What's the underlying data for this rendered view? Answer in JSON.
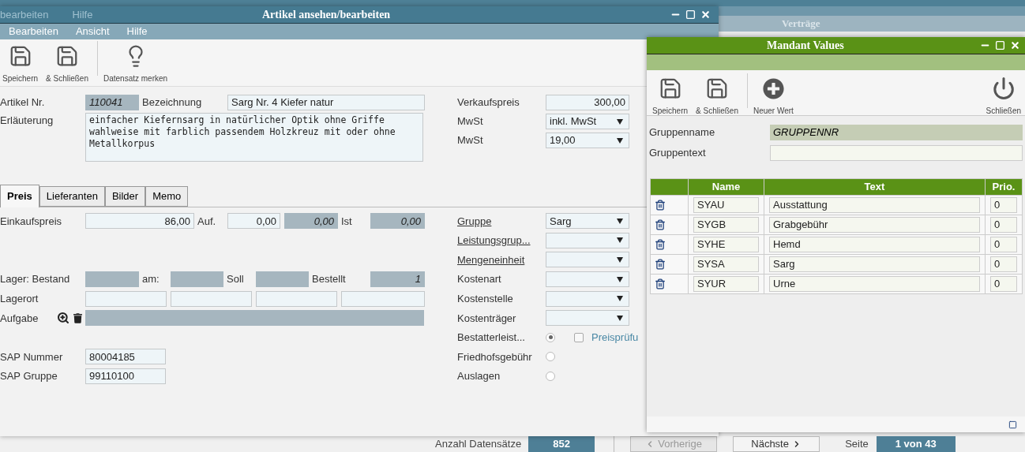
{
  "background": {
    "menu": [
      "bearbeiten",
      "Hilfe"
    ],
    "title": "Verträge",
    "footer": {
      "count_label": "Anzahl Datensätze",
      "count": "852",
      "prev": {
        "label": "Vorherige",
        "disabled": true
      },
      "next": {
        "label": "Nächste",
        "disabled": false
      },
      "page_label": "Seite",
      "page": "1 von 43"
    }
  },
  "article_window": {
    "title": "Artikel ansehen/bearbeiten",
    "menu": [
      "Bearbeiten",
      "Ansicht",
      "Hilfe"
    ],
    "toolbar": [
      {
        "label": "Speichern",
        "separator_before": false
      },
      {
        "label": "& Schließen",
        "separator_before": false
      },
      {
        "label": "Datensatz merken",
        "separator_before": true
      }
    ],
    "article_no": {
      "label": "Artikel Nr.",
      "value": "110041"
    },
    "name": {
      "label": "Bezeichnung",
      "value": "Sarg Nr. 4 Kiefer natur"
    },
    "description": {
      "label": "Erläuterung",
      "value": "einfacher Kiefernsarg in natürlicher Optik ohne Griffe wahlweise mit farblich passendem Holzkreuz mit oder ohne Metallkorpus"
    },
    "price_fields": [
      {
        "label": "Verkaufspreis",
        "kind": "input",
        "value": "300,00"
      },
      {
        "label": "MwSt",
        "kind": "select",
        "value": "inkl. MwSt"
      },
      {
        "label": "MwSt",
        "kind": "select",
        "value": "19,00"
      }
    ],
    "tabs": [
      {
        "label": "Preis",
        "selected": true
      },
      {
        "label": "Lieferanten",
        "selected": false
      },
      {
        "label": "Bilder",
        "selected": false
      },
      {
        "label": "Memo",
        "selected": false
      }
    ],
    "left_rows": [
      {
        "items": [
          {
            "kind": "label",
            "text": "Einkaufspreis"
          },
          {
            "kind": "input",
            "value": "86,00"
          },
          {
            "kind": "label",
            "text": "Auf."
          },
          {
            "kind": "input",
            "value": "0,00"
          },
          {
            "kind": "readonly",
            "value": "0,00"
          },
          {
            "kind": "label",
            "text": "Ist"
          },
          {
            "kind": "readonly",
            "value": "0,00"
          }
        ]
      },
      {
        "items": []
      },
      {
        "items": []
      },
      {
        "items": [
          {
            "kind": "label",
            "text": "Lager: Bestand"
          },
          {
            "kind": "readonly",
            "value": ""
          },
          {
            "kind": "label",
            "text": "am:"
          },
          {
            "kind": "readonly",
            "value": ""
          },
          {
            "kind": "label",
            "text": "Soll"
          },
          {
            "kind": "readonly",
            "value": ""
          },
          {
            "kind": "label",
            "text": "Bestellt"
          },
          {
            "kind": "readonly",
            "value": "1"
          }
        ]
      },
      {
        "items": [
          {
            "kind": "label",
            "text": "Lagerort"
          },
          {
            "kind": "input",
            "value": ""
          },
          {
            "kind": "input",
            "value": ""
          },
          {
            "kind": "input",
            "value": ""
          },
          {
            "kind": "input",
            "value": ""
          }
        ]
      },
      {
        "items": [
          {
            "kind": "label",
            "text": "Aufgabe"
          },
          {
            "kind": "icons"
          },
          {
            "kind": "readonly",
            "value": ""
          }
        ]
      },
      {
        "items": []
      },
      {
        "items": [
          {
            "kind": "label",
            "text": "SAP Nummer"
          },
          {
            "kind": "input",
            "value": "80004185"
          }
        ]
      },
      {
        "items": [
          {
            "kind": "label",
            "text": "SAP Gruppe"
          },
          {
            "kind": "input",
            "value": "99110100"
          }
        ]
      }
    ],
    "right_rows": [
      {
        "label": "Gruppe",
        "link": true,
        "kind": "select",
        "value": "Sarg"
      },
      {
        "label": "Leistungsgrup...",
        "link": true,
        "kind": "select",
        "value": ""
      },
      {
        "label": "Mengeneinheit",
        "link": true,
        "kind": "select",
        "value": ""
      },
      {
        "label": "Kostenart",
        "link": false,
        "kind": "select",
        "value": ""
      },
      {
        "label": "Kostenstelle",
        "link": false,
        "kind": "select",
        "value": ""
      },
      {
        "label": "Kostenträger",
        "link": false,
        "kind": "select",
        "value": ""
      },
      {
        "label": "Bestatterleist...",
        "link": false,
        "kind": "radio",
        "selected": true,
        "check": {
          "label": "Preisprüfu",
          "checked": false
        }
      },
      {
        "label": "Friedhofsgebühr",
        "link": false,
        "kind": "radio",
        "selected": false
      },
      {
        "label": "Auslagen",
        "link": false,
        "kind": "radio",
        "selected": false
      }
    ]
  },
  "mandant_window": {
    "title": "Mandant Values",
    "toolbar": [
      {
        "label": "Speichern",
        "separator_before": false
      },
      {
        "label": "& Schließen",
        "separator_before": false
      },
      {
        "label": "Neuer Wert",
        "separator_before": true
      }
    ],
    "toolbar_end": [
      {
        "label": "Schließen"
      }
    ],
    "group_name": {
      "label": "Gruppenname",
      "value": "GRUPPENNR"
    },
    "group_text": {
      "label": "Gruppentext"
    },
    "table": {
      "columns": [
        "Name",
        "Text",
        "Prio."
      ],
      "rows": [
        {
          "name": "SYAU",
          "text": "Ausstattung",
          "prio": "0"
        },
        {
          "name": "SYGB",
          "text": "Grabgebühr",
          "prio": "0"
        },
        {
          "name": "SYHE",
          "text": "Hemd",
          "prio": "0"
        },
        {
          "name": "SYSA",
          "text": "Sarg",
          "prio": "0"
        },
        {
          "name": "SYUR",
          "text": "Urne",
          "prio": "0"
        }
      ]
    }
  }
}
